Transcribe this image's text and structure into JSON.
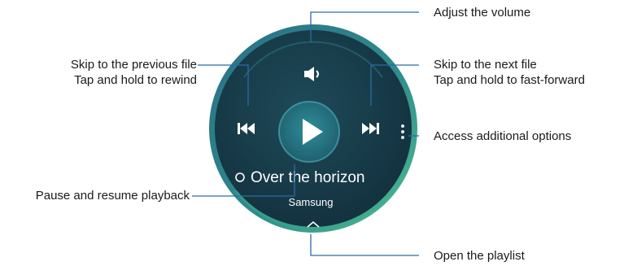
{
  "callouts": {
    "volume": "Adjust the volume",
    "next_line1": "Skip to the next file",
    "next_line2": "Tap and hold to fast-forward",
    "options": "Access additional options",
    "playlist": "Open the playlist",
    "prev_line1": "Skip to the previous file",
    "prev_line2": "Tap and hold to rewind",
    "pause": "Pause and resume playback"
  },
  "watch_screen": {
    "track_title": "Over the horizon",
    "artist": "Samsung",
    "buttons": [
      "volume-icon",
      "previous-icon",
      "play-icon",
      "next-icon",
      "more-options-icon",
      "playlist-chevron-icon"
    ]
  },
  "colors": {
    "callout_line": "#2b6ca3",
    "screen_dark": "#1b3a48",
    "screen_teal": "#2b7f90",
    "ring_green": "#46b08a",
    "text_white": "#ffffff"
  }
}
